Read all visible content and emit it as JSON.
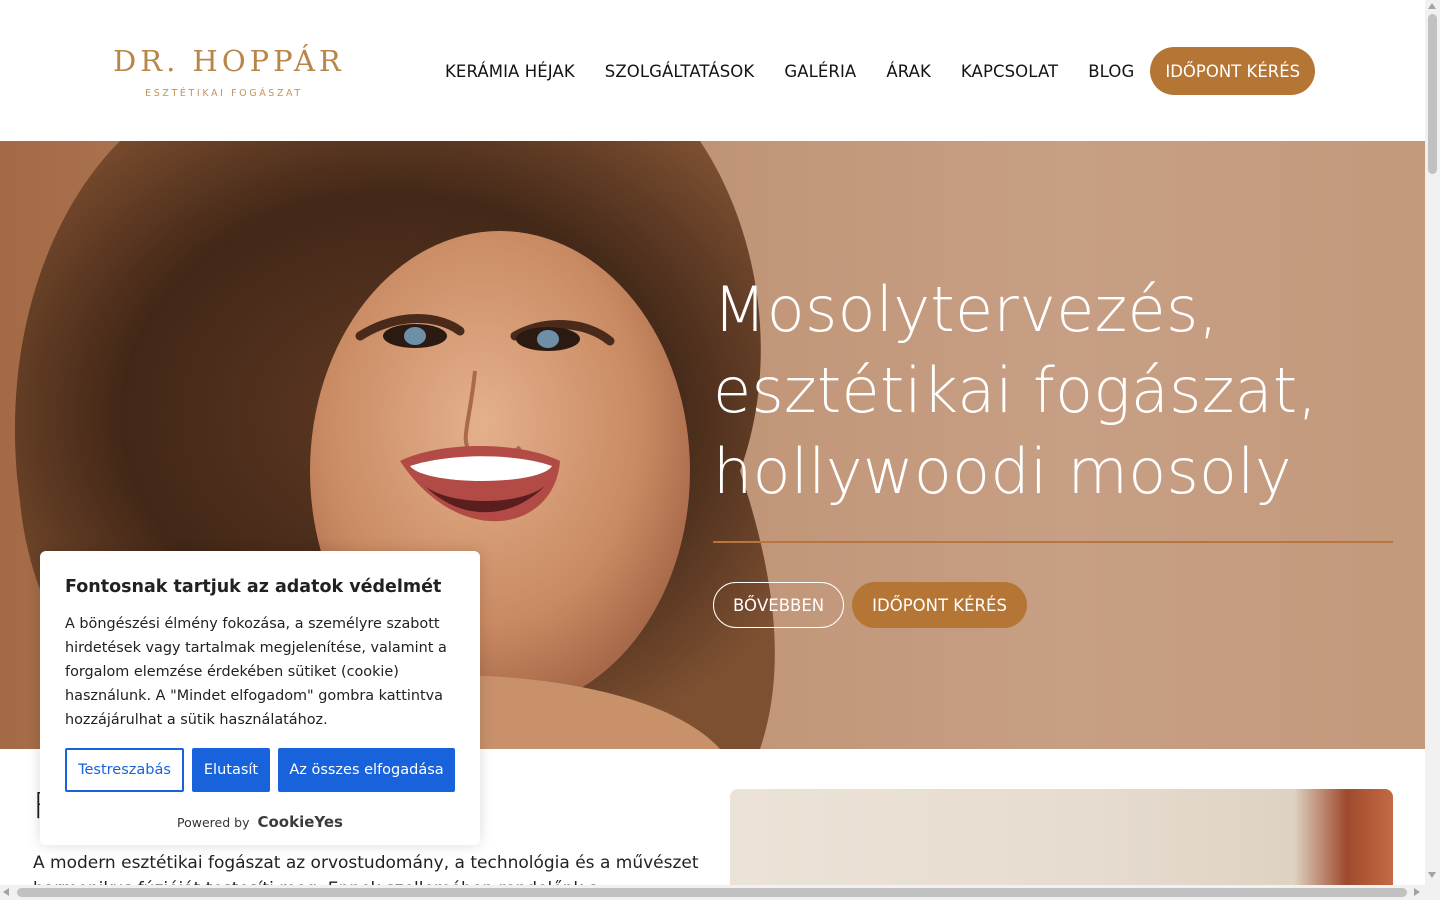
{
  "logo": {
    "name": "DR. HOPPÁR",
    "tagline": "ESZTÉTIKAI FOGÁSZAT"
  },
  "nav": {
    "items": [
      {
        "label": "KERÁMIA HÉJAK"
      },
      {
        "label": "SZOLGÁLTATÁSOK"
      },
      {
        "label": "GALÉRIA"
      },
      {
        "label": "ÁRAK"
      },
      {
        "label": "KAPCSOLAT"
      },
      {
        "label": "BLOG"
      }
    ],
    "cta_label": "IDŐPONT KÉRÉS"
  },
  "hero": {
    "title_lines": [
      "Mosolytervezés,",
      "esztétikai fogászat,",
      "hollywoodi mosoly"
    ],
    "more_label": "BŐVEBBEN",
    "appointment_label": "IDŐPONT KÉRÉS"
  },
  "section": {
    "heading": "F",
    "paragraph": "A modern esztétikai fogászat az orvostudomány, a technológia és a művészet harmonikus fúzióját testesíti meg. Ennek szellemében rendelőnk a"
  },
  "cookie_banner": {
    "title": "Fontosnak tartjuk az adatok védelmét",
    "text": "A böngészési élmény fokozása, a személyre szabott hirdetések vagy tartalmak megjelenítése, valamint a forgalom elemzése érdekében sütiket (cookie) használunk. A \"Mindet elfogadom\" gombra kattintva hozzájárulhat a sütik használatához.",
    "customize_label": "Testreszabás",
    "reject_label": "Elutasít",
    "accept_label": "Az összes elfogadása",
    "powered_by": "Powered by",
    "brand": "CookieYes"
  },
  "colors": {
    "accent": "#b57535",
    "logo": "#b98649",
    "cookie_button": "#1863dc"
  }
}
